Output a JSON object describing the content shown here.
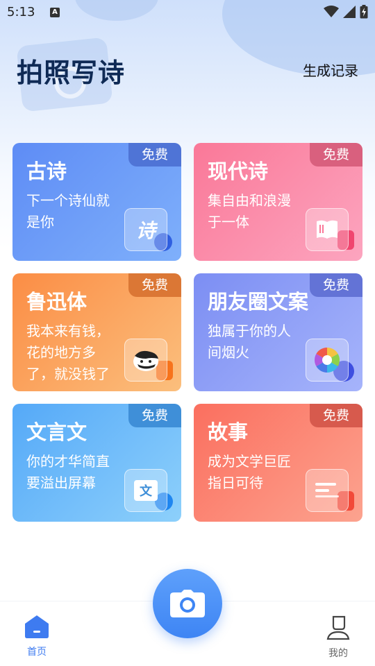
{
  "status_bar": {
    "time": "5:13",
    "notification_letter": "A",
    "icons": [
      "wifi-icon",
      "signal-icon",
      "battery-charging-icon"
    ]
  },
  "header": {
    "title": "拍照写诗",
    "history_link": "生成记录"
  },
  "cards": [
    {
      "title": "古诗",
      "desc": "下一个诗仙就是你",
      "badge": "免费",
      "icon": "poem-book-icon",
      "icon_text": "诗",
      "color": "#6a98f7"
    },
    {
      "title": "现代诗",
      "desc": "集自由和浪漫于一体",
      "badge": "免费",
      "icon": "open-book-icon",
      "color": "#fa8aa8"
    },
    {
      "title": "鲁迅体",
      "desc": "我本来有钱，花的地方多了，就没钱了",
      "badge": "免费",
      "icon": "luxun-portrait-icon",
      "color": "#fb9d57"
    },
    {
      "title": "朋友圈文案",
      "desc": "独属于你的人间烟火",
      "badge": "免费",
      "icon": "camera-aperture-icon",
      "color": "#8b9df6"
    },
    {
      "title": "文言文",
      "desc": "你的才华简直要溢出屏幕",
      "badge": "免费",
      "icon": "classical-text-icon",
      "icon_text": "文",
      "color": "#6ab9f9"
    },
    {
      "title": "故事",
      "desc": "成为文学巨匠指日可待",
      "badge": "免费",
      "icon": "document-lines-icon",
      "color": "#fc8473"
    }
  ],
  "bottom_nav": {
    "home_label": "首页",
    "mine_label": "我的"
  },
  "colors": {
    "accent": "#3e7bf0",
    "title_dark": "#0f2a55"
  }
}
